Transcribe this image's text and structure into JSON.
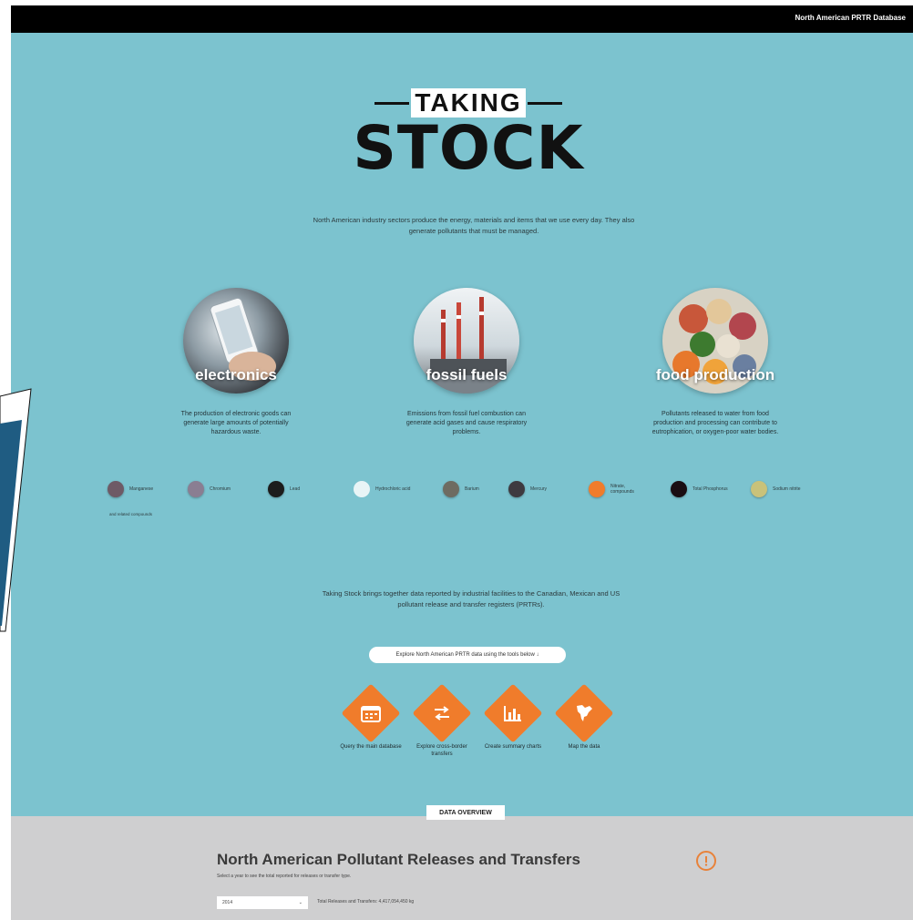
{
  "topbar": {
    "link": "North American PRTR Database"
  },
  "logo": {
    "top_word": "TAKING",
    "main_word": "STOCK"
  },
  "intro": "North American industry sectors produce the energy, materials and items that we use every day. They also generate pollutants that must be managed.",
  "sectors": [
    {
      "title": "electronics",
      "desc": "The production of electronic goods can generate large amounts of potentially hazardous waste."
    },
    {
      "title": "fossil fuels",
      "desc": "Emissions from fossil fuel combustion can generate acid gases and cause respiratory problems."
    },
    {
      "title": "food production",
      "desc": "Pollutants released to water from food production and processing can contribute to eutrophication, or oxygen-poor water bodies."
    }
  ],
  "chemicals": [
    {
      "label": "Manganese",
      "color": "#6e5a66"
    },
    {
      "label": "Chromium",
      "color": "#8a7e92"
    },
    {
      "label": "Lead",
      "color": "#1c1c1c"
    },
    {
      "label": "Hydrochloric acid",
      "color": "#e8f4f6"
    },
    {
      "label": "Barium",
      "color": "#6e6c62"
    },
    {
      "label": "Mercury",
      "color": "#3e3a40"
    },
    {
      "label": "Nitrate, compounds",
      "color": "#f07c2b"
    },
    {
      "label": "Total Phosphorus",
      "color": "#1a0d12"
    },
    {
      "label": "Sodium nitrite",
      "color": "#c9c27a"
    }
  ],
  "chem_footnote": "and related compounds",
  "para2": "Taking Stock brings together data reported by industrial facilities to the Canadian, Mexican and US pollutant release and transfer registers (PRTRs).",
  "explore_label": "Explore North American PRTR data using the tools below ↓",
  "tools": [
    {
      "label": "Query the main database",
      "icon": "calendar-icon"
    },
    {
      "label": "Explore cross-border transfers",
      "icon": "transfer-arrows-icon"
    },
    {
      "label": "Create summary charts",
      "icon": "bar-chart-icon"
    },
    {
      "label": "Map the data",
      "icon": "north-america-map-icon"
    }
  ],
  "overview": {
    "tab": "DATA OVERVIEW",
    "title": "North American Pollutant Releases and Transfers",
    "subtitle": "Select a year to see the total reported for releases or transfer type.",
    "year_value": "2014",
    "total_text": "Total Releases and Transfers: 4,417,054,450 kg"
  }
}
